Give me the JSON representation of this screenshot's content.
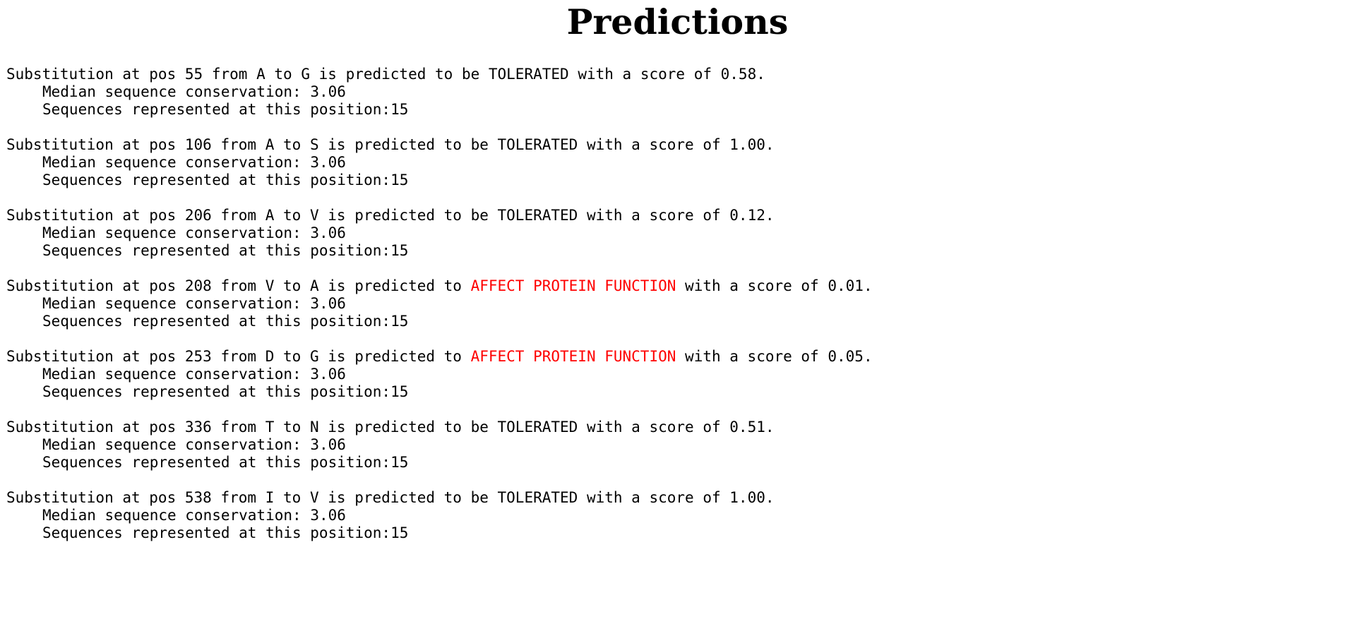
{
  "title": "Predictions",
  "colors": {
    "affect": "#ff0000",
    "text": "#000000"
  },
  "labels": {
    "prefix": "Substitution at pos",
    "from": "from",
    "to": "to",
    "is_predicted": "is predicted to",
    "with_score": "with a score of",
    "median_label": "Median sequence conservation:",
    "seq_label": "Sequences represented at this position:"
  },
  "predictions": [
    {
      "pos": "55",
      "from": "A",
      "to": "G",
      "verdict": "be TOLERATED",
      "affect": false,
      "score": "0.58",
      "median": "3.06",
      "seqs": "15"
    },
    {
      "pos": "106",
      "from": "A",
      "to": "S",
      "verdict": "be TOLERATED",
      "affect": false,
      "score": "1.00",
      "median": "3.06",
      "seqs": "15"
    },
    {
      "pos": "206",
      "from": "A",
      "to": "V",
      "verdict": "be TOLERATED",
      "affect": false,
      "score": "0.12",
      "median": "3.06",
      "seqs": "15"
    },
    {
      "pos": "208",
      "from": "V",
      "to": "A",
      "verdict": "AFFECT PROTEIN FUNCTION",
      "affect": true,
      "score": "0.01",
      "median": "3.06",
      "seqs": "15"
    },
    {
      "pos": "253",
      "from": "D",
      "to": "G",
      "verdict": "AFFECT PROTEIN FUNCTION",
      "affect": true,
      "score": "0.05",
      "median": "3.06",
      "seqs": "15"
    },
    {
      "pos": "336",
      "from": "T",
      "to": "N",
      "verdict": "be TOLERATED",
      "affect": false,
      "score": "0.51",
      "median": "3.06",
      "seqs": "15"
    },
    {
      "pos": "538",
      "from": "I",
      "to": "V",
      "verdict": "be TOLERATED",
      "affect": false,
      "score": "1.00",
      "median": "3.06",
      "seqs": "15"
    }
  ]
}
